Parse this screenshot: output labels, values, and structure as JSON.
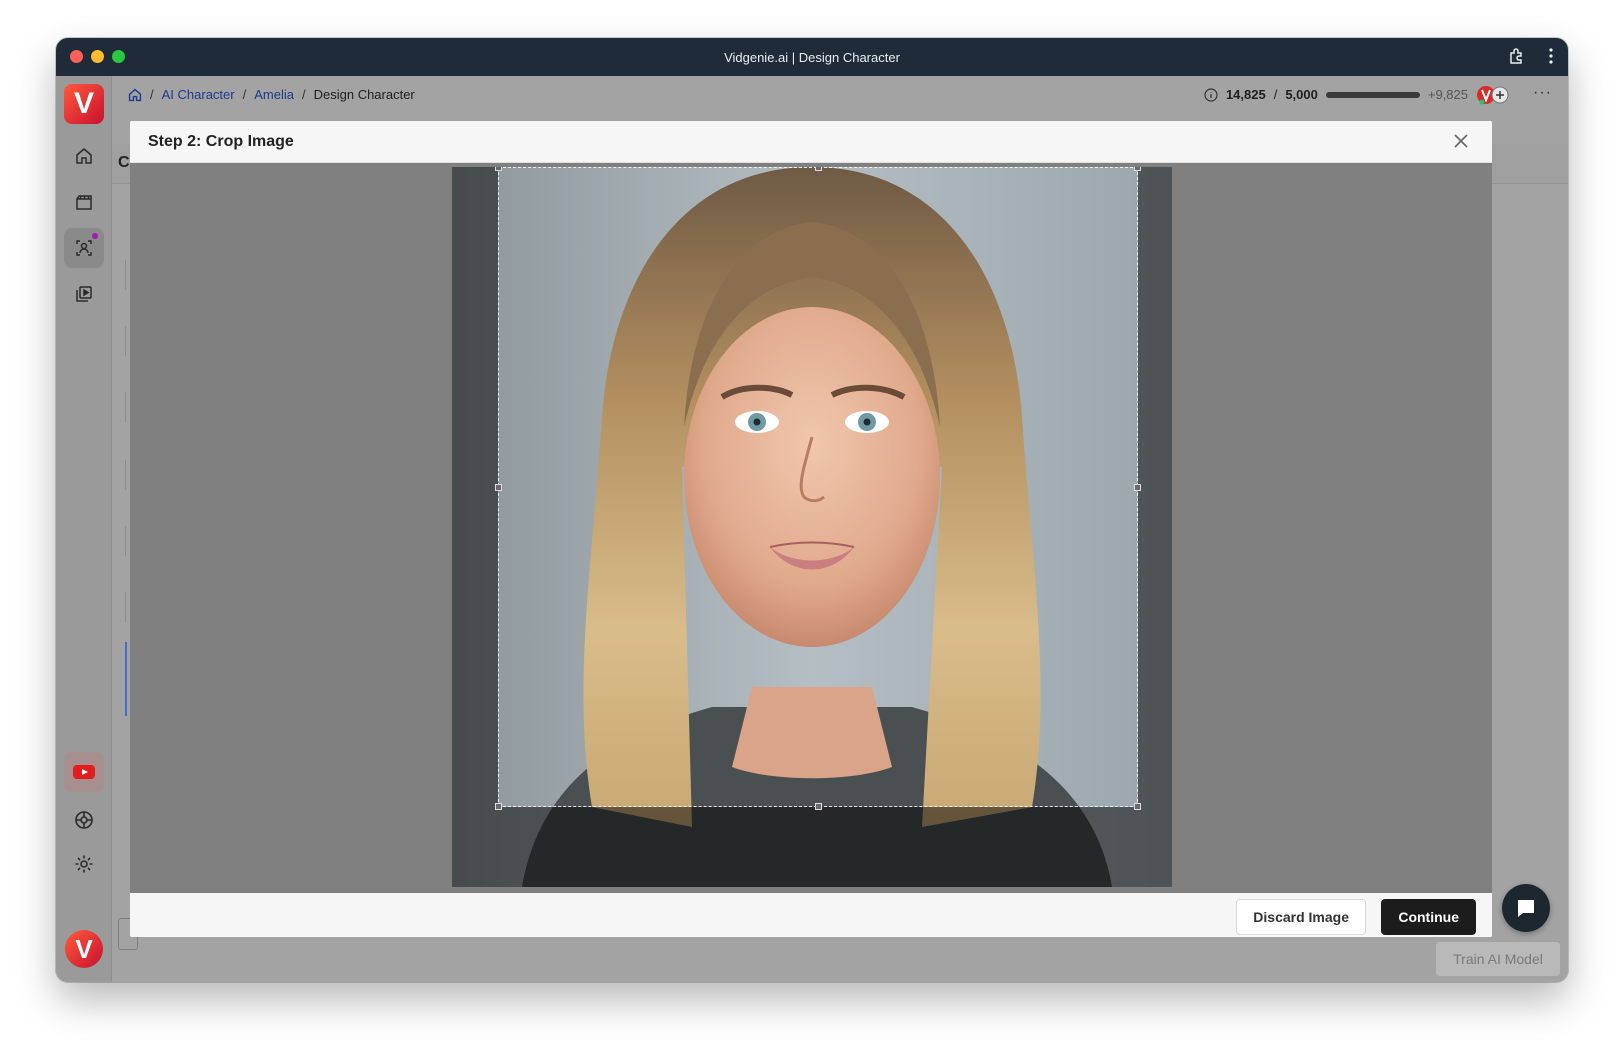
{
  "window": {
    "title": "Vidgenie.ai | Design Character"
  },
  "sidebar": {
    "logo_letter": "V",
    "items": [
      {
        "icon": "home-icon"
      },
      {
        "icon": "clapperboard-icon"
      },
      {
        "icon": "ai-character-icon",
        "active": true
      },
      {
        "icon": "video-library-icon"
      }
    ],
    "bottom_items": [
      {
        "icon": "youtube-icon"
      },
      {
        "icon": "support-icon"
      },
      {
        "icon": "gear-icon"
      }
    ],
    "avatar_letter": "V"
  },
  "breadcrumb": {
    "items": [
      {
        "label": "AI Character",
        "link": true
      },
      {
        "label": "Amelia",
        "link": true
      },
      {
        "label": "Design Character",
        "link": false
      }
    ],
    "separator": "/"
  },
  "credits": {
    "used": "14,825",
    "total": "5,000",
    "extra": "+9,825",
    "progress": 1.0
  },
  "background": {
    "section_initial": "C",
    "train_button": "Train AI Model"
  },
  "modal": {
    "title": "Step 2: Crop Image",
    "discard_label": "Discard Image",
    "continue_label": "Continue"
  },
  "colors": {
    "titlebar": "#1f2b38",
    "brand_red": "#e8392a",
    "continue_bg": "#1c1c1c",
    "link": "#1e3a8a"
  }
}
